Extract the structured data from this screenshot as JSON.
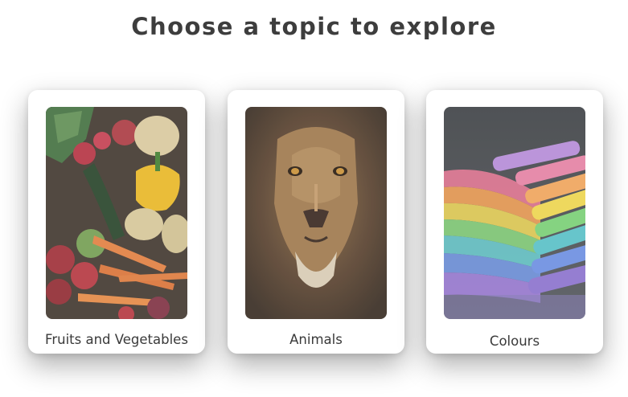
{
  "heading": "Choose a topic to explore",
  "topics": [
    {
      "label": "Fruits and Vegetables",
      "image": "fruits-vegetables-photo"
    },
    {
      "label": "Animals",
      "image": "lion-photo"
    },
    {
      "label": "Colours",
      "image": "chalk-colours-photo"
    }
  ]
}
